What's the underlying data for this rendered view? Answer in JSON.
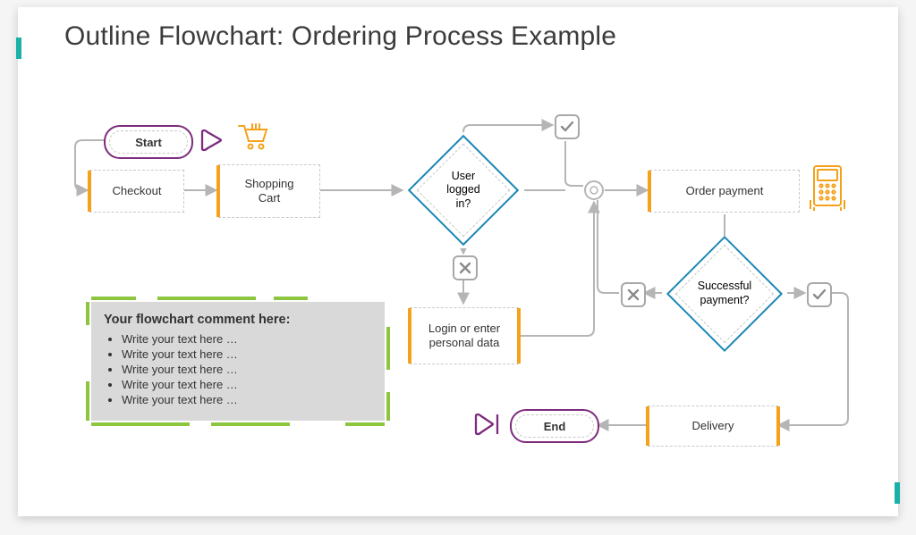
{
  "title": "Outline Flowchart: Ordering Process Example",
  "nodes": {
    "start": "Start",
    "checkout": "Checkout",
    "cart": "Shopping\nCart",
    "logged_q": "User\nlogged\nin?",
    "login": "Login or enter\npersonal data",
    "order_pay": "Order payment",
    "pay_q": "Successful\npayment?",
    "delivery": "Delivery",
    "end": "End"
  },
  "comment": {
    "heading": "Your flowchart comment here:",
    "bullets": [
      "Write your text here …",
      "Write your text here …",
      "Write your text here …",
      "Write your text here …",
      "Write your text here …"
    ]
  },
  "colors": {
    "accent_purple": "#7d2b7d",
    "accent_orange": "#f5a11a",
    "accent_blue": "#1b87b5",
    "accent_teal": "#1ab1a9",
    "accent_green": "#8cc63f",
    "arrow": "#b5b5b5"
  }
}
